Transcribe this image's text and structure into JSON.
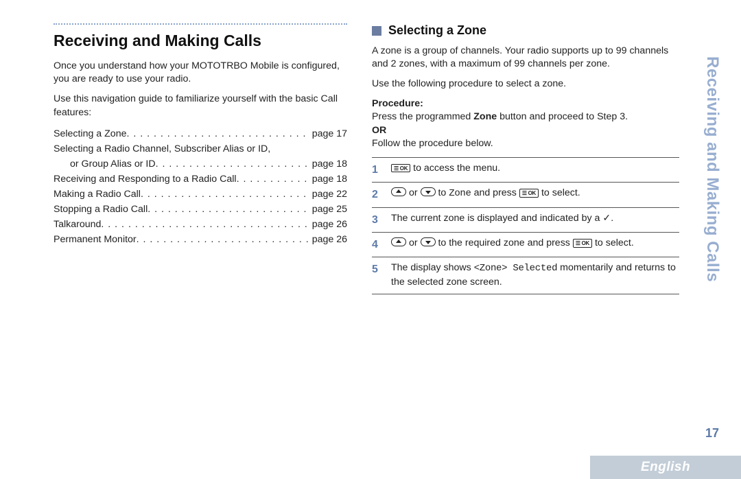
{
  "side_title": "Receiving and Making Calls",
  "page_number": "17",
  "language_tab": "English",
  "left": {
    "heading": "Receiving and Making Calls",
    "intro1": "Once you understand how your MOTOTRBO Mobile is configured, you are ready to use your radio.",
    "intro2": "Use this navigation guide to familiarize yourself with the basic Call features:",
    "toc": [
      {
        "label": "Selecting a Zone",
        "page": "page 17"
      },
      {
        "label": "Selecting a Radio Channel, Subscriber Alias or ID,",
        "sub": "or Group Alias or ID",
        "page": "page 18"
      },
      {
        "label": "Receiving and Responding to a Radio Call",
        "page": "page 18"
      },
      {
        "label": "Making a Radio Call",
        "page": "page 22"
      },
      {
        "label": "Stopping a Radio Call",
        "page": "page 25"
      },
      {
        "label": "Talkaround",
        "page": "page 26"
      },
      {
        "label": "Permanent Monitor",
        "page": "page 26"
      }
    ]
  },
  "right": {
    "subheading": "Selecting a Zone",
    "para1": "A zone is a group of channels. Your radio supports up to 99 channels and 2 zones, with a maximum of 99 channels per zone.",
    "para2": "Use the following procedure to select a zone.",
    "procedure_label": "Procedure:",
    "procedure_line_a": "Press the programmed ",
    "procedure_zone_bold": "Zone",
    "procedure_line_b": " button and proceed to Step 3.",
    "or_label": "OR",
    "procedure_follow": "Follow the procedure below.",
    "steps": {
      "s1_tail": " to access the menu.",
      "s2_mid": " to ",
      "s2_zone": "Zone",
      "s2_press": " and press ",
      "s2_tail": " to select.",
      "s3": "The current zone is displayed and indicated by a ",
      "s3_check": "✓",
      "s3_period": ".",
      "s4_mid": " to the required zone and press ",
      "s4_tail": " to select.",
      "s5_a": "The display shows ",
      "s5_mono": "<Zone> Selected",
      "s5_b": " momentarily and returns to the selected zone screen.",
      "or_word": " or "
    }
  }
}
